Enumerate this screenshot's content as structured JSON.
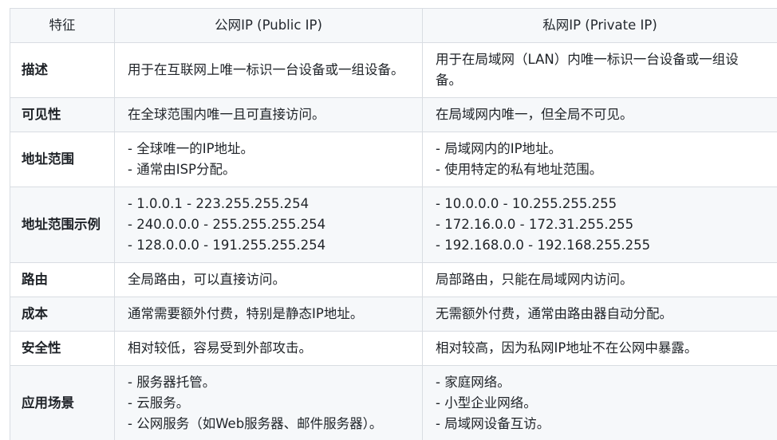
{
  "table": {
    "headers": [
      "特征",
      "公网IP (Public IP)",
      "私网IP (Private IP)"
    ],
    "rows": [
      {
        "feature": "描述",
        "public": [
          "用于在互联网上唯一标识一台设备或一组设备。"
        ],
        "private": [
          "用于在局域网（LAN）内唯一标识一台设备或一组设备。"
        ]
      },
      {
        "feature": "可见性",
        "public": [
          "在全球范围内唯一且可直接访问。"
        ],
        "private": [
          "在局域网内唯一，但全局不可见。"
        ]
      },
      {
        "feature": "地址范围",
        "public": [
          "- 全球唯一的IP地址。",
          "- 通常由ISP分配。"
        ],
        "private": [
          "- 局域网内的IP地址。",
          "- 使用特定的私有地址范围。"
        ]
      },
      {
        "feature": "地址范围示例",
        "public": [
          "- 1.0.0.1 - 223.255.255.254",
          "- 240.0.0.0 - 255.255.255.254",
          "- 128.0.0.0 - 191.255.255.254"
        ],
        "private": [
          "- 10.0.0.0 - 10.255.255.255",
          "- 172.16.0.0 - 172.31.255.255",
          "- 192.168.0.0 - 192.168.255.255"
        ]
      },
      {
        "feature": "路由",
        "public": [
          "全局路由，可以直接访问。"
        ],
        "private": [
          "局部路由，只能在局域网内访问。"
        ]
      },
      {
        "feature": "成本",
        "public": [
          "通常需要额外付费，特别是静态IP地址。"
        ],
        "private": [
          "无需额外付费，通常由路由器自动分配。"
        ]
      },
      {
        "feature": "安全性",
        "public": [
          "相对较低，容易受到外部攻击。"
        ],
        "private": [
          "相对较高，因为私网IP地址不在公网中暴露。"
        ]
      },
      {
        "feature": "应用场景",
        "public": [
          "- 服务器托管。",
          "- 云服务。",
          "- 公网服务（如Web服务器、邮件服务器）。"
        ],
        "private": [
          "- 家庭网络。",
          "- 小型企业网络。",
          "- 局域网设备互访。"
        ]
      }
    ]
  }
}
